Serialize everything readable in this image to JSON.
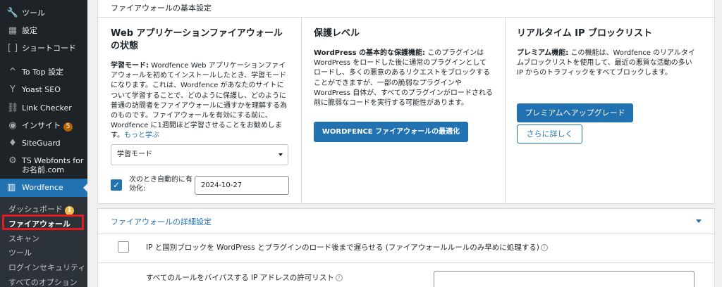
{
  "sidebar": {
    "items": [
      {
        "label": "ツール",
        "icon": "wrench-icon"
      },
      {
        "label": "設定",
        "icon": "settings-icon"
      },
      {
        "label": "ショートコード",
        "icon": "brackets-icon"
      },
      {
        "label": "To Top 設定",
        "icon": "arrow-up-icon"
      },
      {
        "label": "Yoast SEO",
        "icon": "yoast-icon"
      },
      {
        "label": "Link Checker",
        "icon": "link-checker-icon"
      },
      {
        "label": "インサイト",
        "icon": "insights-icon",
        "badge": "5"
      },
      {
        "label": "SiteGuard",
        "icon": "siteguard-icon"
      },
      {
        "label": "TS Webfonts for お名前.com",
        "icon": "gear-icon"
      },
      {
        "label": "Wordfence",
        "icon": "wordfence-icon"
      }
    ],
    "submenu": [
      {
        "label": "ダッシュボード",
        "badge": "1"
      },
      {
        "label": "ファイアウォール"
      },
      {
        "label": "スキャン"
      },
      {
        "label": "ツール"
      },
      {
        "label": "ログインセキュリティ"
      },
      {
        "label": "すべてのオプション"
      }
    ]
  },
  "basic": {
    "title": "ファイアウォールの基本設定",
    "col1": {
      "heading": "Web アプリケーションファイアウォールの状態",
      "lead": "学習モード:",
      "text": " Wordfence Web アプリケーションファイアウォールを初めてインストールしたとき、学習モードになります。これは、Wordfence があなたのサイトについて学習することで、どのように保護し、どのように普通の訪問者をファイアウォールに通すかを理解する為のものです。ファイアウォールを有効にする前に、Wordfence に1週間ほど学習させることをお勧めします。",
      "more_link": "もっと学ぶ",
      "select_value": "学習モード",
      "auto_label": "次のとき自動的に有効化:",
      "date_value": "2024-10-27"
    },
    "col2": {
      "heading": "保護レベル",
      "lead": "WordPress の基本的な保護機能:",
      "text": " このプラグインは WordPress をロードした後に通常のプラグインとしてロードし、多くの悪意のあるリクエストをブロックすることができますが、一部の脆弱なプラグインや WordPress 自体が、すべてのプラグインがロードされる前に脆弱なコードを実行する可能性があります。",
      "button": "WORDFENCE ファイアウォールの最適化"
    },
    "col3": {
      "heading": "リアルタイム IP ブロックリスト",
      "lead": "プレミアム機能:",
      "text": " この機能は、Wordfence のリアルタイムブロックリストを使用して、最近の悪質な活動の多い IP からのトラフィックをすべてブロックします。",
      "upgrade_button": "プレミアムへアップグレード",
      "more_button": "さらに詳しく"
    }
  },
  "advanced": {
    "title": "ファイアウォールの詳細設定",
    "ip_block_label": "IP と国別ブロックを WordPress とプラグインのロード後まで遅らせる (ファイアウォールルールのみ早めに処理する)",
    "allowlist_label": "すべてのルールをバイパスする IP アドレスの許可リスト",
    "help_glyph": "?"
  }
}
